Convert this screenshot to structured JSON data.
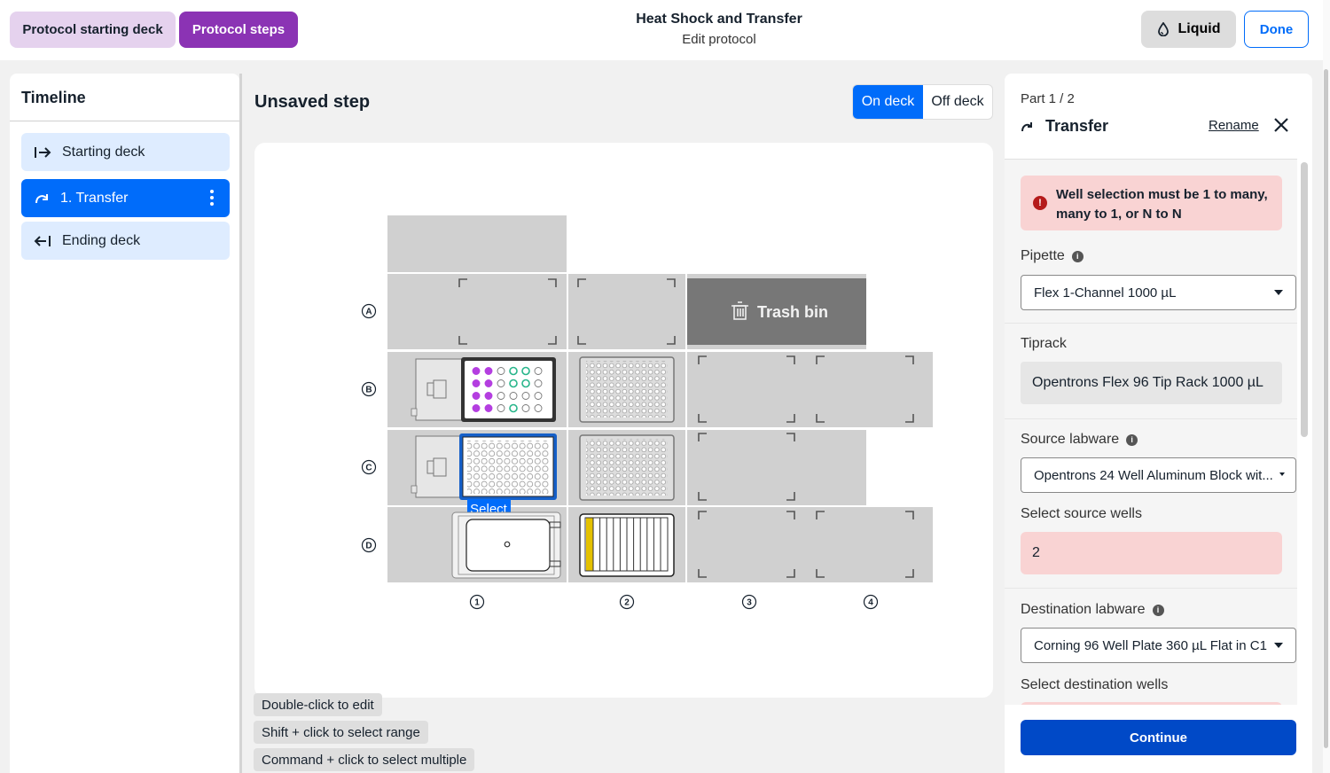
{
  "header": {
    "tab_start": "Protocol starting deck",
    "tab_steps": "Protocol steps",
    "title": "Heat Shock and Transfer",
    "subtitle": "Edit protocol",
    "liquid_label": "Liquid",
    "done_label": "Done"
  },
  "timeline": {
    "title": "Timeline",
    "items": [
      {
        "label": "Starting deck",
        "icon": "arrow-right-bar-icon",
        "active": false
      },
      {
        "label": "1. Transfer",
        "icon": "transfer-curve-icon",
        "active": true
      },
      {
        "label": "Ending deck",
        "icon": "arrow-left-bar-icon",
        "active": false
      }
    ]
  },
  "center": {
    "step_title": "Unsaved step",
    "toggle_on": "On deck",
    "toggle_off": "Off deck",
    "rows": [
      "A",
      "B",
      "C",
      "D"
    ],
    "cols": [
      "1",
      "2",
      "3",
      "4"
    ],
    "trash_label": "Trash bin",
    "select_label": "Select",
    "hints": [
      "Double-click to edit",
      "Shift + click to select range",
      "Command + click to select multiple"
    ]
  },
  "panel": {
    "part": "Part 1 / 2",
    "title": "Transfer",
    "rename": "Rename",
    "error": "Well selection must be 1 to many, many to 1, or N to N",
    "pipette_label": "Pipette",
    "pipette_value": "Flex 1-Channel 1000 µL",
    "tiprack_label": "Tiprack",
    "tiprack_value": "Opentrons Flex 96 Tip Rack 1000 µL",
    "source_label": "Source labware",
    "source_value": "Opentrons 24 Well Aluminum Block wit...",
    "source_wells_label": "Select source wells",
    "source_wells_value": "2",
    "dest_label": "Destination labware",
    "dest_value": "Corning 96 Well Plate 360 µL Flat in C1",
    "dest_wells_label": "Select destination wells",
    "continue": "Continue"
  },
  "colors": {
    "accent_blue": "#006cfa",
    "purple": "#8b33b4",
    "error_bg": "#f9d3d3",
    "liquid_purple": "#b43ee0",
    "liquid_green": "#27b58a",
    "slot_gray": "#d0d0d0"
  }
}
